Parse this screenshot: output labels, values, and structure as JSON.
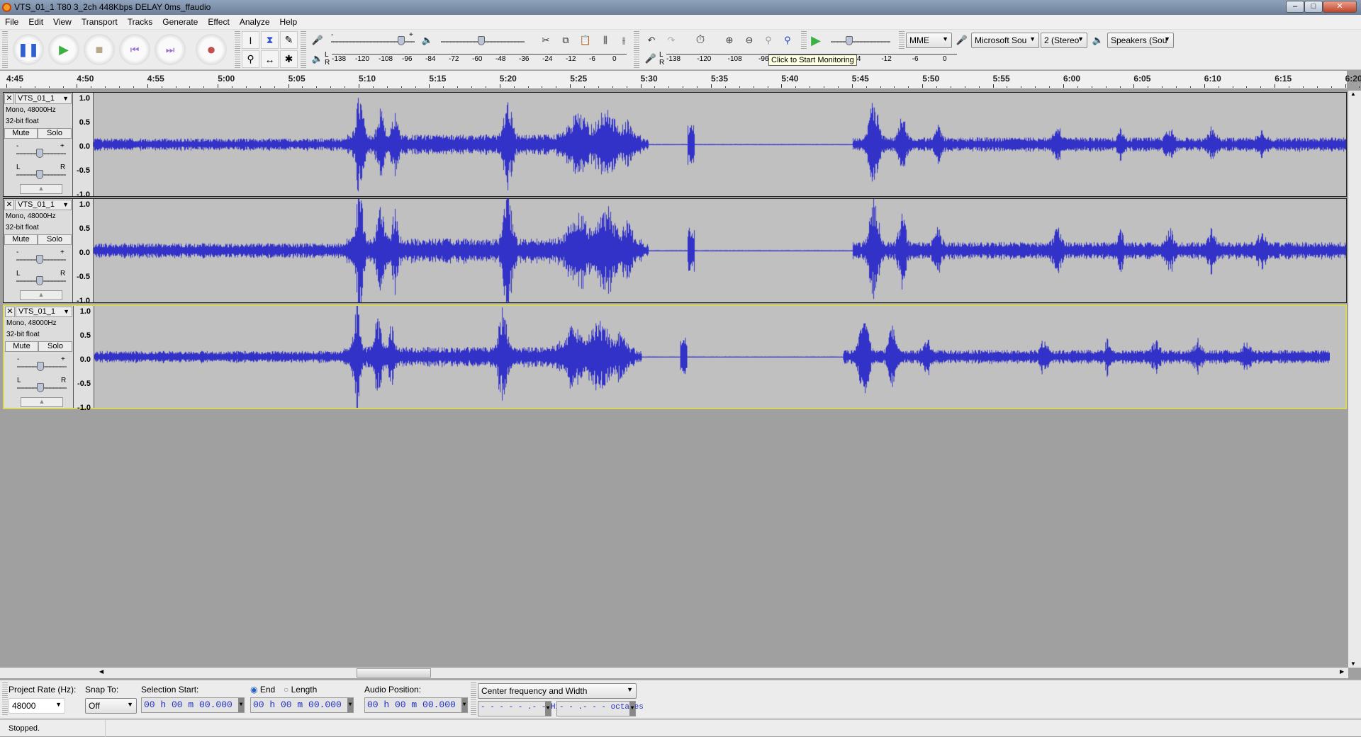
{
  "window": {
    "title": "VTS_01_1 T80 3_2ch 448Kbps DELAY 0ms_ffaudio",
    "minimize": "–",
    "maximize": "□",
    "close": "✕"
  },
  "menu": [
    "File",
    "Edit",
    "View",
    "Transport",
    "Tracks",
    "Generate",
    "Effect",
    "Analyze",
    "Help"
  ],
  "transport": {
    "buttons": [
      "pause",
      "play",
      "stop",
      "skip-to-start",
      "skip-to-end",
      "record"
    ],
    "accent": {
      "play": "#3cb043",
      "record": "#c0504d",
      "pause": "#3060d0"
    }
  },
  "tools": [
    "selection-tool",
    "envelope-tool",
    "draw-tool",
    "zoom-tool",
    "time-shift-tool",
    "multi-tool"
  ],
  "meters": {
    "record_scale": [
      "-138",
      "-120",
      "-108",
      "-96",
      "-84",
      "-72",
      "-60",
      "-48",
      "-36",
      "-24",
      "-12",
      "-6",
      "0"
    ],
    "playback_scale": [
      "-138",
      "-120",
      "-108",
      "-96",
      "-48",
      "-36",
      "-24",
      "-12",
      "-6",
      "0"
    ],
    "record_level_labels": {
      "minus": "-",
      "plus": "+"
    },
    "meter_lr": {
      "l": "L",
      "r": "R"
    },
    "tooltip": "Click to Start Monitoring"
  },
  "device": {
    "host": "MME",
    "recording_device": "Microsoft Sou",
    "channels": "2 (Stereo",
    "playback_device": "Speakers (Sou"
  },
  "ruler": {
    "labels": [
      "4:45",
      "4:50",
      "4:55",
      "5:00",
      "5:05",
      "5:10",
      "5:15",
      "5:20",
      "5:25",
      "5:30",
      "5:35",
      "5:40",
      "5:45",
      "5:50",
      "5:55",
      "6:00",
      "6:05",
      "6:10",
      "6:15",
      "6:20"
    ]
  },
  "tracks": [
    {
      "name": "VTS_01_1",
      "info1": "Mono, 48000Hz",
      "info2": "32-bit float",
      "mute": "Mute",
      "solo": "Solo",
      "gain_minus": "-",
      "gain_plus": "+",
      "pan_l": "L",
      "pan_r": "R",
      "selected": false,
      "scale": [
        "1.0",
        "0.5",
        "0.0",
        "-0.5",
        "-1.0"
      ]
    },
    {
      "name": "VTS_01_1",
      "info1": "Mono, 48000Hz",
      "info2": "32-bit float",
      "mute": "Mute",
      "solo": "Solo",
      "gain_minus": "-",
      "gain_plus": "+",
      "pan_l": "L",
      "pan_r": "R",
      "selected": false,
      "scale": [
        "1.0",
        "0.5",
        "0.0",
        "-0.5",
        "-1.0"
      ]
    },
    {
      "name": "VTS_01_1",
      "info1": "Mono, 48000Hz",
      "info2": "32-bit float",
      "mute": "Mute",
      "solo": "Solo",
      "gain_minus": "-",
      "gain_plus": "+",
      "pan_l": "L",
      "pan_r": "R",
      "selected": true,
      "scale": [
        "1.0",
        "0.5",
        "0.0",
        "-0.5",
        "-1.0"
      ]
    }
  ],
  "waveform_color": "#3232c8",
  "selection_toolbar": {
    "project_rate_label": "Project Rate (Hz):",
    "project_rate": "48000",
    "snap_label": "Snap To:",
    "snap": "Off",
    "sel_start_label": "Selection Start:",
    "end_label": "End",
    "length_label": "Length",
    "end_selected": true,
    "sel_start": "00 h 00 m 00.000 s",
    "sel_end": "00 h 00 m 00.000 s",
    "audio_pos_label": "Audio Position:",
    "audio_pos": "00 h 00 m 00.000 s",
    "spectral_mode": "Center frequency and Width",
    "freq": "- - - - - .- -  Hz",
    "width": "- - .- - -   octaves"
  },
  "status": "Stopped."
}
